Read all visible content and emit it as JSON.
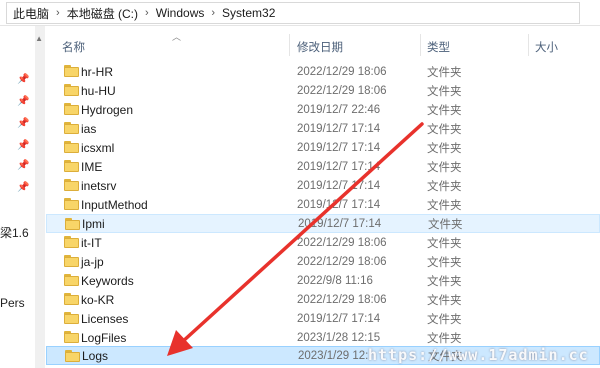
{
  "breadcrumb": [
    "此电脑",
    "本地磁盘 (C:)",
    "Windows",
    "System32"
  ],
  "nav": {
    "labels": [
      "梁1.6",
      "Pers"
    ]
  },
  "columns": {
    "name": "名称",
    "date": "修改日期",
    "type": "类型",
    "size": "大小"
  },
  "rows": [
    {
      "name": "hr-HR",
      "date": "2022/12/29 18:06",
      "type": "文件夹"
    },
    {
      "name": "hu-HU",
      "date": "2022/12/29 18:06",
      "type": "文件夹"
    },
    {
      "name": "Hydrogen",
      "date": "2019/12/7 22:46",
      "type": "文件夹"
    },
    {
      "name": "ias",
      "date": "2019/12/7 17:14",
      "type": "文件夹"
    },
    {
      "name": "icsxml",
      "date": "2019/12/7 17:14",
      "type": "文件夹"
    },
    {
      "name": "IME",
      "date": "2019/12/7 17:14",
      "type": "文件夹"
    },
    {
      "name": "inetsrv",
      "date": "2019/12/7 17:14",
      "type": "文件夹"
    },
    {
      "name": "InputMethod",
      "date": "2019/12/7 17:14",
      "type": "文件夹"
    },
    {
      "name": "Ipmi",
      "date": "2019/12/7 17:14",
      "type": "文件夹"
    },
    {
      "name": "it-IT",
      "date": "2022/12/29 18:06",
      "type": "文件夹"
    },
    {
      "name": "ja-jp",
      "date": "2022/12/29 18:06",
      "type": "文件夹"
    },
    {
      "name": "Keywords",
      "date": "2022/9/8 11:16",
      "type": "文件夹"
    },
    {
      "name": "ko-KR",
      "date": "2022/12/29 18:06",
      "type": "文件夹"
    },
    {
      "name": "Licenses",
      "date": "2019/12/7 17:14",
      "type": "文件夹"
    },
    {
      "name": "LogFiles",
      "date": "2023/1/28 12:15",
      "type": "文件夹"
    },
    {
      "name": "Logs",
      "date": "2023/1/29 12:",
      "type": "文件夹"
    }
  ],
  "watermark": "https://www.17admin.cc",
  "colors": {
    "hover": "#e5f3ff",
    "selected": "#cce8ff",
    "arrow": "#e8322c",
    "folder": "#f8d568"
  }
}
